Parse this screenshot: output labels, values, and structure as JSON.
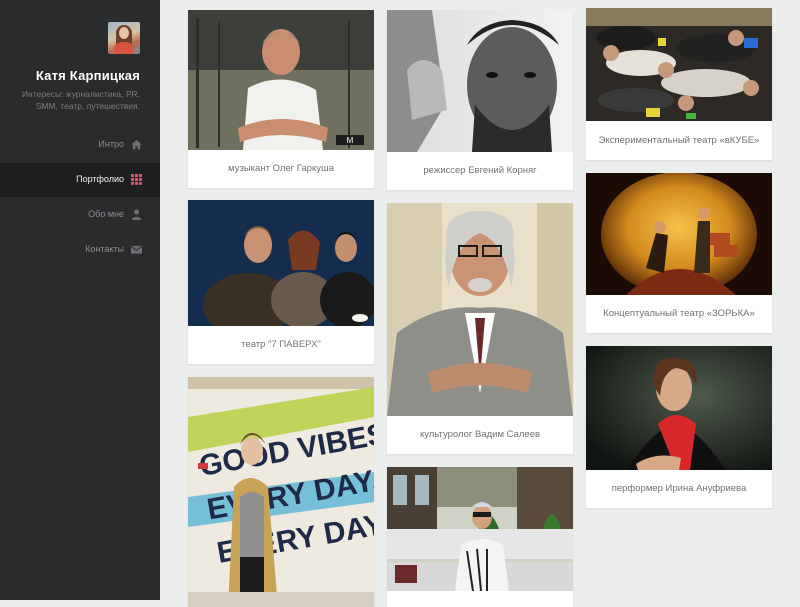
{
  "sidebar": {
    "name": "Катя Карпицкая",
    "description": "Интересы: журналистика, PR, SMM, театр, путешествия.",
    "nav": [
      {
        "label": "Интро",
        "icon": "home-icon"
      },
      {
        "label": "Портфолио",
        "icon": "grid-icon",
        "active": true
      },
      {
        "label": "Обо мне",
        "icon": "user-icon"
      },
      {
        "label": "Контакты",
        "icon": "envelope-icon"
      }
    ]
  },
  "colors": {
    "sidebar_bg": "#2a2b2d",
    "active_bg": "#1e1f21",
    "accent": "#e0526a",
    "page_bg": "#eceeed"
  },
  "portfolio": [
    {
      "caption": "музыкант Олег Гаркуша",
      "watermark": "M"
    },
    {
      "caption": "режиссер Евгений Корняг"
    },
    {
      "caption": "Экспериментальный театр «вКУБЕ»"
    },
    {
      "caption": "театр \"7 ПАВЕРХ\""
    },
    {
      "caption": "культуролог Вадим Салеев"
    },
    {
      "caption": "Концептуальный театр «ЗОРЬКА»"
    },
    {
      "caption": "перформер Ирина Ануфриева"
    },
    {
      "caption": "",
      "wall_text": [
        "GOOD VIBES.",
        "EVERY DAY.",
        "EVERY DAY."
      ]
    },
    {
      "caption": ""
    }
  ]
}
